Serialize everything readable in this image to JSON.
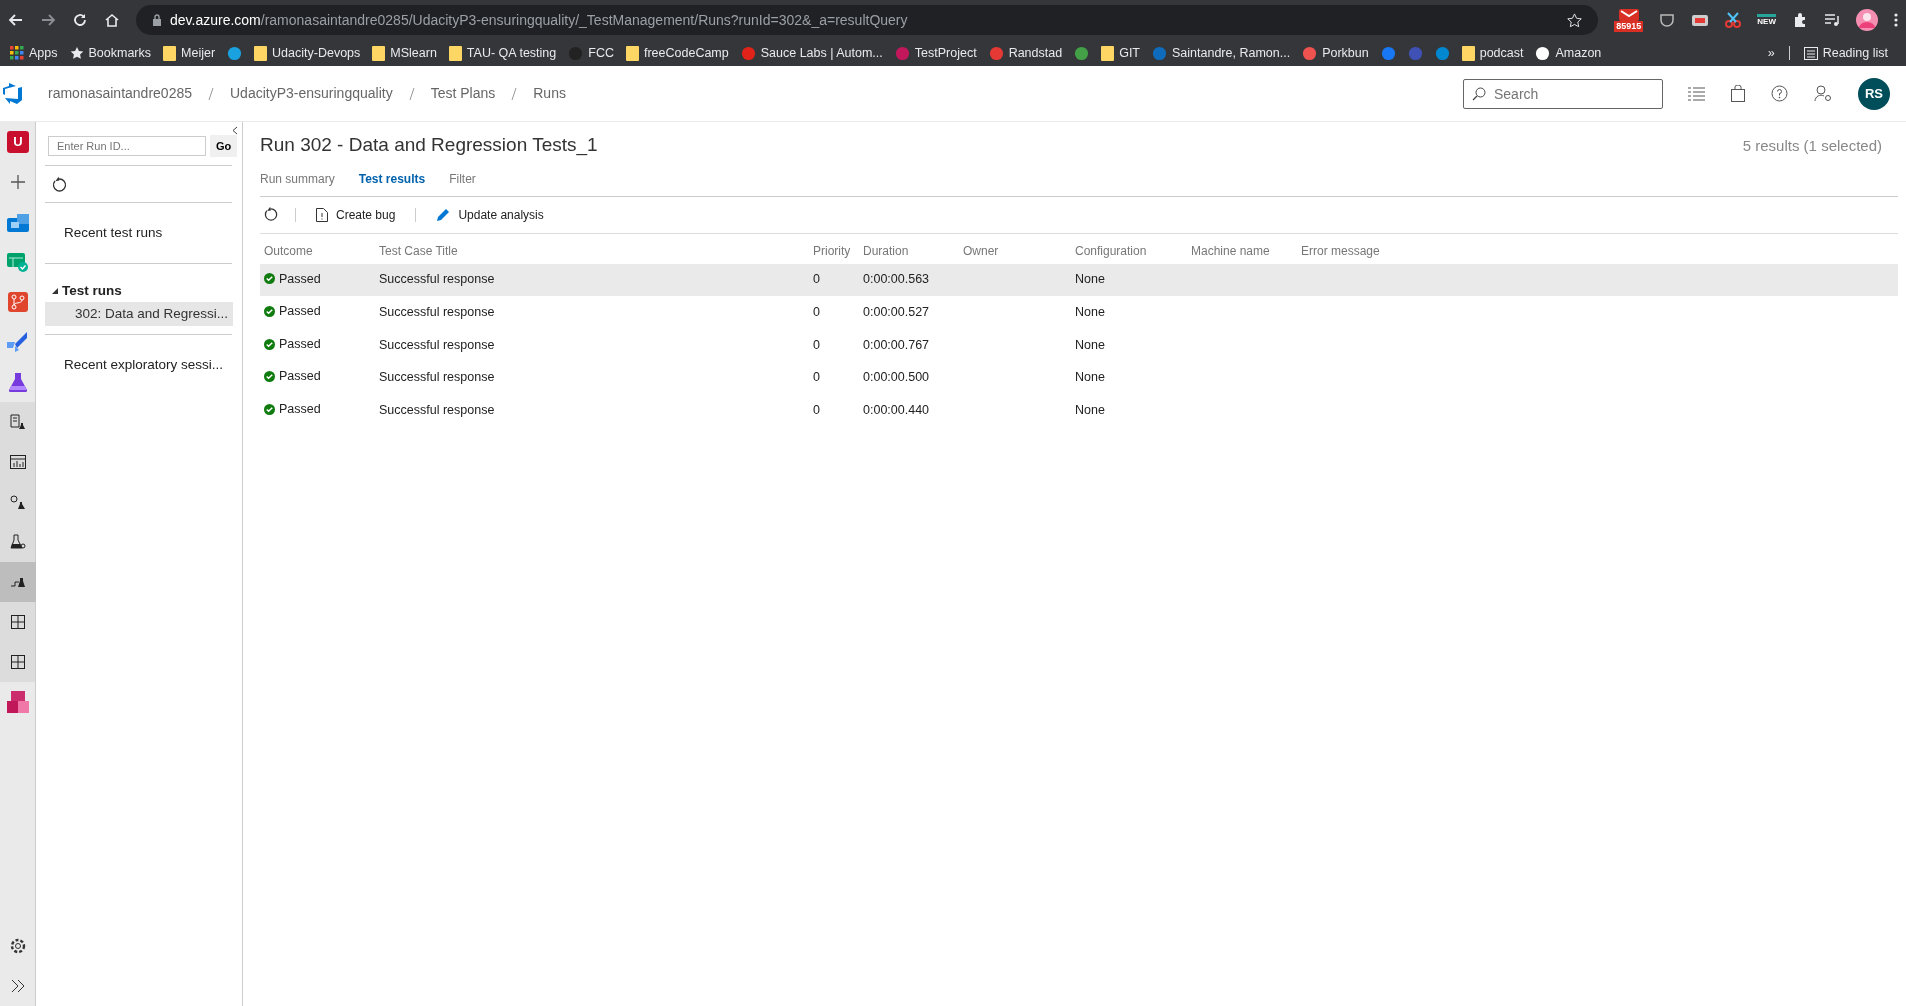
{
  "browser": {
    "url_host": "dev.azure.com",
    "url_path": "/ramonasaintandre0285/UdacityP3-ensuringquality/_TestManagement/Runs?runId=302&_a=resultQuery",
    "extension_badge": "85915",
    "extension_new": "NEW",
    "bookmarks": [
      {
        "kind": "apps",
        "label": "Apps"
      },
      {
        "kind": "star",
        "label": "Bookmarks"
      },
      {
        "kind": "folder",
        "label": "Meijer"
      },
      {
        "kind": "site",
        "color": "#1aa2e0"
      },
      {
        "kind": "folder",
        "label": "Udacity-Devops"
      },
      {
        "kind": "folder",
        "label": "MSlearn"
      },
      {
        "kind": "folder",
        "label": "TAU- QA testing"
      },
      {
        "kind": "site",
        "color": "#222222",
        "label": "FCC"
      },
      {
        "kind": "folder",
        "label": "freeCodeCamp"
      },
      {
        "kind": "site",
        "color": "#e2231a",
        "label": "Sauce Labs | Autom..."
      },
      {
        "kind": "site",
        "color": "#c2185b",
        "label": "TestProject"
      },
      {
        "kind": "site",
        "color": "#e53935",
        "label": "Randstad"
      },
      {
        "kind": "site",
        "color": "#43a047"
      },
      {
        "kind": "folder",
        "label": "GIT"
      },
      {
        "kind": "site",
        "color": "#0f6cbd",
        "label": "Saintandre, Ramon..."
      },
      {
        "kind": "site",
        "color": "#ef5350",
        "label": "Porkbun"
      },
      {
        "kind": "site",
        "color": "#1877f2"
      },
      {
        "kind": "site",
        "color": "#3f51b5"
      },
      {
        "kind": "site",
        "color": "#0288d1"
      },
      {
        "kind": "folder",
        "label": "podcast"
      },
      {
        "kind": "site",
        "color": "#ffffff",
        "label": "Amazon"
      }
    ],
    "overflow": "»",
    "reading_list": "Reading list"
  },
  "header": {
    "breadcrumbs": [
      "ramonasaintandre0285",
      "UdacityP3-ensuringquality",
      "Test Plans",
      "Runs"
    ],
    "search": {
      "placeholder": "Search"
    },
    "avatar": "RS"
  },
  "rail": {
    "items": [
      {
        "kind": "org",
        "label": "U",
        "selected": false
      },
      {
        "kind": "add",
        "selected": false
      },
      {
        "kind": "boards",
        "selected": false
      },
      {
        "kind": "checked",
        "selected": false
      },
      {
        "kind": "repos",
        "selected": false
      },
      {
        "kind": "pipelines",
        "selected": false
      },
      {
        "kind": "testplans",
        "selected": false,
        "expanded": true,
        "children": [
          {
            "kind": "doc",
            "selected": false
          },
          {
            "kind": "chart",
            "selected": false
          },
          {
            "kind": "at",
            "selected": false
          },
          {
            "kind": "gear-flask",
            "selected": false
          },
          {
            "kind": "steps",
            "selected": true
          },
          {
            "kind": "grid",
            "selected": false
          },
          {
            "kind": "grid",
            "selected": false
          }
        ]
      },
      {
        "kind": "artifacts",
        "selected": false
      }
    ]
  },
  "side": {
    "run_id": {
      "placeholder": "Enter Run ID..."
    },
    "go": "Go",
    "recent_runs": "Recent test runs",
    "tree": {
      "label": "Test runs",
      "expanded": true,
      "children": [
        {
          "label": "302: Data and Regressi...",
          "selected": true
        }
      ]
    },
    "recent_sessions": "Recent exploratory sessi..."
  },
  "main": {
    "title": "Run 302 - Data and Regression Tests_1",
    "summary": "5 results (1 selected)",
    "tabs": [
      {
        "label": "Run summary",
        "selected": false
      },
      {
        "label": "Test results",
        "selected": true
      },
      {
        "label": "Filter",
        "selected": false
      }
    ],
    "toolbar": [
      "Create bug",
      "Update analysis"
    ],
    "table": {
      "columns": [
        "Outcome",
        "Test Case Title",
        "Priority",
        "Duration",
        "Owner",
        "Configuration",
        "Machine name",
        "Error message"
      ],
      "rows": [
        {
          "selected": true,
          "outcome": {
            "kind": "passed",
            "text": "Passed"
          },
          "title": "Successful response",
          "priority": "0",
          "duration": "0:00:00.563",
          "configuration": "None"
        },
        {
          "selected": false,
          "outcome": {
            "kind": "passed",
            "text": "Passed"
          },
          "title": "Successful response",
          "priority": "0",
          "duration": "0:00:00.527",
          "configuration": "None"
        },
        {
          "selected": false,
          "outcome": {
            "kind": "passed",
            "text": "Passed"
          },
          "title": "Successful response",
          "priority": "0",
          "duration": "0:00:00.767",
          "configuration": "None"
        },
        {
          "selected": false,
          "outcome": {
            "kind": "passed",
            "text": "Passed"
          },
          "title": "Successful response",
          "priority": "0",
          "duration": "0:00:00.500",
          "configuration": "None"
        },
        {
          "selected": false,
          "outcome": {
            "kind": "passed",
            "text": "Passed"
          },
          "title": "Successful response",
          "priority": "0",
          "duration": "0:00:00.440",
          "configuration": "None"
        }
      ]
    }
  }
}
